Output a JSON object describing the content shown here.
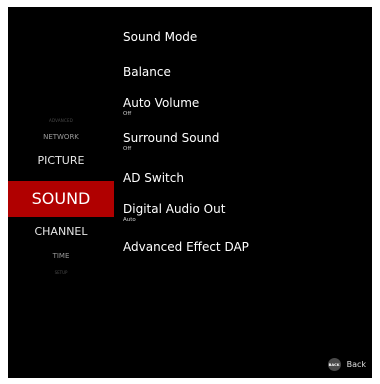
{
  "nav": {
    "advanced": "ADVANCED",
    "network": "NETWORK",
    "picture": "PICTURE",
    "sound": "SOUND",
    "channel": "CHANNEL",
    "time": "TIME",
    "setup": "SETUP",
    "selected": "SOUND",
    "highlight_color": "#b00000"
  },
  "menu": {
    "items": [
      {
        "label": "Sound Mode",
        "value": ""
      },
      {
        "label": "Balance",
        "value": ""
      },
      {
        "label": "Auto Volume",
        "value": "Off"
      },
      {
        "label": "Surround Sound",
        "value": "Off"
      },
      {
        "label": "AD Switch",
        "value": ""
      },
      {
        "label": "Digital Audio Out",
        "value": "Auto"
      },
      {
        "label": "Advanced Effect DAP",
        "value": ""
      }
    ]
  },
  "footer": {
    "back_icon_text": "BACK",
    "back_label": "Back"
  }
}
